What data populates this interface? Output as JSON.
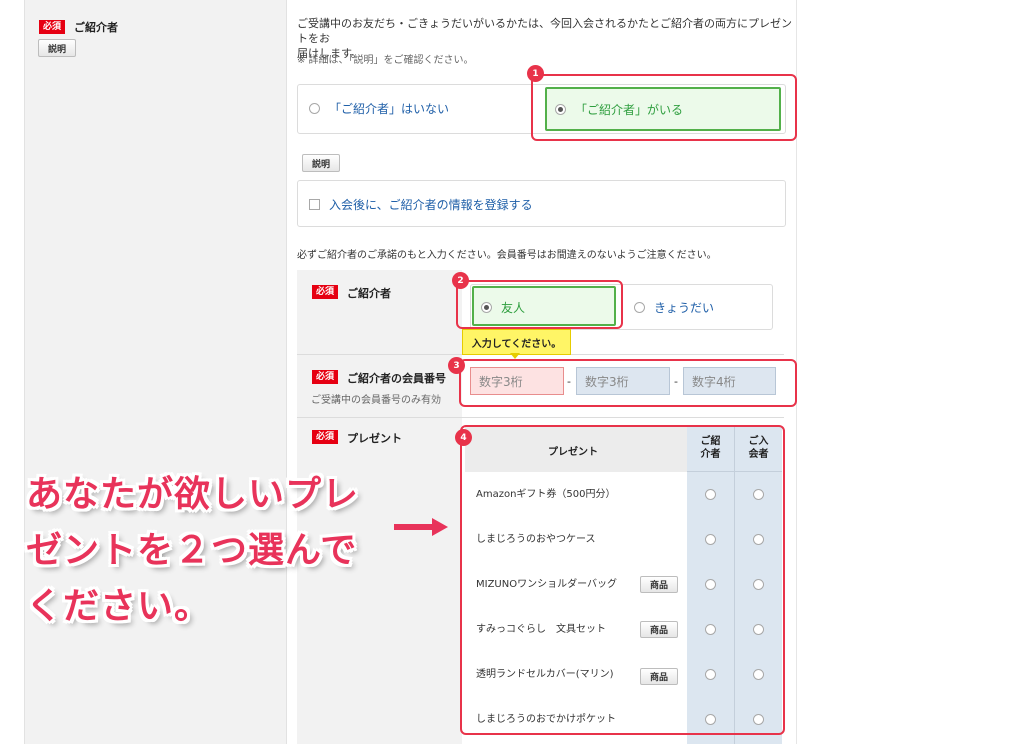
{
  "sidebar": {
    "required_badge": "必須",
    "label": "ご紹介者",
    "explain_button": "説明"
  },
  "intro": {
    "line1": "ご受講中のお友だち・ごきょうだいがいるかたは、今回入会されるかたとご紹介者の両方にプレゼントをお",
    "line2": "届けします。",
    "note": "※ 詳細は、「説明」をご確認ください。"
  },
  "referrer_choice": {
    "option_none": "「ご紹介者」はいない",
    "option_exists": "「ご紹介者」がいる",
    "selected": "option_exists"
  },
  "explain_button2": "説明",
  "register_later": {
    "label": "入会後に、ご紹介者の情報を登録する",
    "checked": false
  },
  "consent_note": "必ずご紹介者のご承諾のもと入力ください。会員番号はお間違えのないようご注意ください。",
  "form": {
    "required_badge": "必須",
    "relation": {
      "label": "ご紹介者",
      "option_friend": "友人",
      "option_sibling": "きょうだい",
      "selected": "option_friend"
    },
    "tooltip": "入力してください。",
    "member_number": {
      "label": "ご紹介者の会員番号",
      "sub": "ご受講中の会員番号のみ有効",
      "placeholder1": "数字3桁",
      "placeholder2": "数字3桁",
      "placeholder3": "数字4桁",
      "separator": "-"
    },
    "present": {
      "label": "プレゼント",
      "col_present": "プレゼント",
      "col_referrer_1": "ご紹",
      "col_referrer_2": "介者",
      "col_member_1": "ご入",
      "col_member_2": "会者",
      "product_button": "商品",
      "items": [
        {
          "name": "Amazonギフト券（500円分）",
          "has_product": false
        },
        {
          "name": "しまじろうのおやつケース",
          "has_product": false
        },
        {
          "name": "MIZUNOワンショルダーバッグ",
          "has_product": true
        },
        {
          "name": "すみっコぐらし　文具セット",
          "has_product": true
        },
        {
          "name": "透明ランドセルカバー(マリン)",
          "has_product": true
        },
        {
          "name": "しまじろうのおでかけポケット",
          "has_product": false
        }
      ]
    }
  },
  "callouts": {
    "n1": "1",
    "n2": "2",
    "n3": "3",
    "n4": "4"
  },
  "overlay_text": {
    "line1": "あなたが欲しいプレ",
    "line2": "ゼントを２つ選んで",
    "line3": "ください。"
  },
  "colors": {
    "accent_red": "#e8334a",
    "required_red": "#e60012",
    "selected_green": "#53b04a",
    "link_blue": "#1f5fa8"
  }
}
